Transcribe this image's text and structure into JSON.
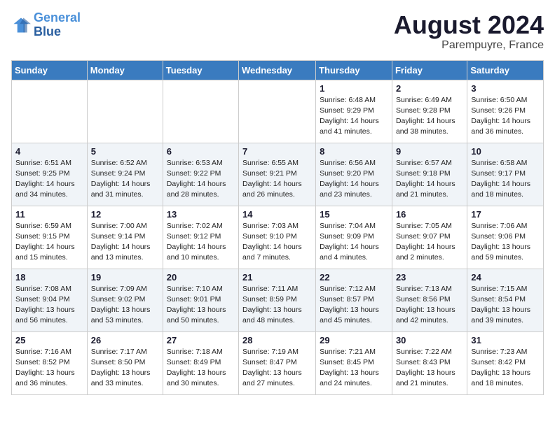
{
  "header": {
    "logo_line1": "General",
    "logo_line2": "Blue",
    "month_title": "August 2024",
    "subtitle": "Parempuyre, France"
  },
  "weekdays": [
    "Sunday",
    "Monday",
    "Tuesday",
    "Wednesday",
    "Thursday",
    "Friday",
    "Saturday"
  ],
  "weeks": [
    [
      {
        "day": "",
        "info": ""
      },
      {
        "day": "",
        "info": ""
      },
      {
        "day": "",
        "info": ""
      },
      {
        "day": "",
        "info": ""
      },
      {
        "day": "1",
        "info": "Sunrise: 6:48 AM\nSunset: 9:29 PM\nDaylight: 14 hours\nand 41 minutes."
      },
      {
        "day": "2",
        "info": "Sunrise: 6:49 AM\nSunset: 9:28 PM\nDaylight: 14 hours\nand 38 minutes."
      },
      {
        "day": "3",
        "info": "Sunrise: 6:50 AM\nSunset: 9:26 PM\nDaylight: 14 hours\nand 36 minutes."
      }
    ],
    [
      {
        "day": "4",
        "info": "Sunrise: 6:51 AM\nSunset: 9:25 PM\nDaylight: 14 hours\nand 34 minutes."
      },
      {
        "day": "5",
        "info": "Sunrise: 6:52 AM\nSunset: 9:24 PM\nDaylight: 14 hours\nand 31 minutes."
      },
      {
        "day": "6",
        "info": "Sunrise: 6:53 AM\nSunset: 9:22 PM\nDaylight: 14 hours\nand 28 minutes."
      },
      {
        "day": "7",
        "info": "Sunrise: 6:55 AM\nSunset: 9:21 PM\nDaylight: 14 hours\nand 26 minutes."
      },
      {
        "day": "8",
        "info": "Sunrise: 6:56 AM\nSunset: 9:20 PM\nDaylight: 14 hours\nand 23 minutes."
      },
      {
        "day": "9",
        "info": "Sunrise: 6:57 AM\nSunset: 9:18 PM\nDaylight: 14 hours\nand 21 minutes."
      },
      {
        "day": "10",
        "info": "Sunrise: 6:58 AM\nSunset: 9:17 PM\nDaylight: 14 hours\nand 18 minutes."
      }
    ],
    [
      {
        "day": "11",
        "info": "Sunrise: 6:59 AM\nSunset: 9:15 PM\nDaylight: 14 hours\nand 15 minutes."
      },
      {
        "day": "12",
        "info": "Sunrise: 7:00 AM\nSunset: 9:14 PM\nDaylight: 14 hours\nand 13 minutes."
      },
      {
        "day": "13",
        "info": "Sunrise: 7:02 AM\nSunset: 9:12 PM\nDaylight: 14 hours\nand 10 minutes."
      },
      {
        "day": "14",
        "info": "Sunrise: 7:03 AM\nSunset: 9:10 PM\nDaylight: 14 hours\nand 7 minutes."
      },
      {
        "day": "15",
        "info": "Sunrise: 7:04 AM\nSunset: 9:09 PM\nDaylight: 14 hours\nand 4 minutes."
      },
      {
        "day": "16",
        "info": "Sunrise: 7:05 AM\nSunset: 9:07 PM\nDaylight: 14 hours\nand 2 minutes."
      },
      {
        "day": "17",
        "info": "Sunrise: 7:06 AM\nSunset: 9:06 PM\nDaylight: 13 hours\nand 59 minutes."
      }
    ],
    [
      {
        "day": "18",
        "info": "Sunrise: 7:08 AM\nSunset: 9:04 PM\nDaylight: 13 hours\nand 56 minutes."
      },
      {
        "day": "19",
        "info": "Sunrise: 7:09 AM\nSunset: 9:02 PM\nDaylight: 13 hours\nand 53 minutes."
      },
      {
        "day": "20",
        "info": "Sunrise: 7:10 AM\nSunset: 9:01 PM\nDaylight: 13 hours\nand 50 minutes."
      },
      {
        "day": "21",
        "info": "Sunrise: 7:11 AM\nSunset: 8:59 PM\nDaylight: 13 hours\nand 48 minutes."
      },
      {
        "day": "22",
        "info": "Sunrise: 7:12 AM\nSunset: 8:57 PM\nDaylight: 13 hours\nand 45 minutes."
      },
      {
        "day": "23",
        "info": "Sunrise: 7:13 AM\nSunset: 8:56 PM\nDaylight: 13 hours\nand 42 minutes."
      },
      {
        "day": "24",
        "info": "Sunrise: 7:15 AM\nSunset: 8:54 PM\nDaylight: 13 hours\nand 39 minutes."
      }
    ],
    [
      {
        "day": "25",
        "info": "Sunrise: 7:16 AM\nSunset: 8:52 PM\nDaylight: 13 hours\nand 36 minutes."
      },
      {
        "day": "26",
        "info": "Sunrise: 7:17 AM\nSunset: 8:50 PM\nDaylight: 13 hours\nand 33 minutes."
      },
      {
        "day": "27",
        "info": "Sunrise: 7:18 AM\nSunset: 8:49 PM\nDaylight: 13 hours\nand 30 minutes."
      },
      {
        "day": "28",
        "info": "Sunrise: 7:19 AM\nSunset: 8:47 PM\nDaylight: 13 hours\nand 27 minutes."
      },
      {
        "day": "29",
        "info": "Sunrise: 7:21 AM\nSunset: 8:45 PM\nDaylight: 13 hours\nand 24 minutes."
      },
      {
        "day": "30",
        "info": "Sunrise: 7:22 AM\nSunset: 8:43 PM\nDaylight: 13 hours\nand 21 minutes."
      },
      {
        "day": "31",
        "info": "Sunrise: 7:23 AM\nSunset: 8:42 PM\nDaylight: 13 hours\nand 18 minutes."
      }
    ]
  ]
}
